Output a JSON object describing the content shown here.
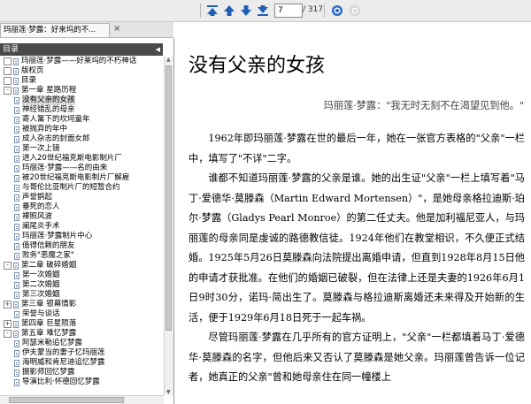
{
  "toolbar": {
    "buttons": [
      "first-page-icon",
      "prev-page-icon",
      "next-page-icon",
      "last-page-icon",
      "zoom-in-icon",
      "zoom-out-icon"
    ],
    "page_value": "7",
    "page_total": "/ 317"
  },
  "tab": {
    "label": "玛丽莲·梦露：好来坞的不...",
    "close": "×"
  },
  "panel": {
    "title": "目录",
    "collapse": "◀"
  },
  "toc": [
    {
      "label": "玛丽莲·梦露——好莱坞的不朽神话",
      "level": 0,
      "expander": "",
      "selected": false
    },
    {
      "label": "版权页",
      "level": 0,
      "expander": "",
      "selected": false
    },
    {
      "label": "目录",
      "level": 0,
      "expander": "",
      "selected": false
    },
    {
      "label": "第一章  星路历程",
      "level": 0,
      "expander": "-",
      "selected": false
    },
    {
      "label": "没有父亲的女孩",
      "level": 1,
      "expander": "",
      "selected": true
    },
    {
      "label": "神经错乱的母亲",
      "level": 1,
      "expander": "",
      "selected": false
    },
    {
      "label": "寄人篱下的坎坷童年",
      "level": 1,
      "expander": "",
      "selected": false
    },
    {
      "label": "被抛弃的年中",
      "level": 1,
      "expander": "",
      "selected": false
    },
    {
      "label": "成人杂志的封面女郎",
      "level": 1,
      "expander": "",
      "selected": false
    },
    {
      "label": "第一次上镜",
      "level": 1,
      "expander": "",
      "selected": false
    },
    {
      "label": "进入20世纪福克斯电影制片厂",
      "level": 1,
      "expander": "",
      "selected": false
    },
    {
      "label": "玛丽莲·梦露——名的由来",
      "level": 1,
      "expander": "",
      "selected": false
    },
    {
      "label": "被20世纪福克斯电影制片厂解雇",
      "level": 1,
      "expander": "",
      "selected": false
    },
    {
      "label": "与哥伦比亚制片厂的短暂合约",
      "level": 1,
      "expander": "",
      "selected": false
    },
    {
      "label": "声誉鹊起",
      "level": 1,
      "expander": "",
      "selected": false
    },
    {
      "label": "垂死的恋人",
      "level": 1,
      "expander": "",
      "selected": false
    },
    {
      "label": "裸照风波",
      "level": 1,
      "expander": "",
      "selected": false
    },
    {
      "label": "阑尾炎手术",
      "level": 1,
      "expander": "",
      "selected": false
    },
    {
      "label": "玛丽莲·梦露制片中心",
      "level": 1,
      "expander": "",
      "selected": false
    },
    {
      "label": "值得信赖的朋友",
      "level": 1,
      "expander": "",
      "selected": false
    },
    {
      "label": "败务\"恶魔之家\"",
      "level": 1,
      "expander": "",
      "selected": false
    },
    {
      "label": "第二章  破碎婚姻",
      "level": 0,
      "expander": "-",
      "selected": false
    },
    {
      "label": "第一次婚姻",
      "level": 1,
      "expander": "",
      "selected": false
    },
    {
      "label": "第二次婚姻",
      "level": 1,
      "expander": "",
      "selected": false
    },
    {
      "label": "第三次婚姻",
      "level": 1,
      "expander": "",
      "selected": false
    },
    {
      "label": "第三章  银幕情影",
      "level": 0,
      "expander": "+",
      "selected": false
    },
    {
      "label": "荣誉与谈话",
      "level": 1,
      "expander": "",
      "selected": false
    },
    {
      "label": "第四章  巨星陨落",
      "level": 0,
      "expander": "+",
      "selected": false
    },
    {
      "label": "第五章  难忆梦露",
      "level": 0,
      "expander": "-",
      "selected": false
    },
    {
      "label": "阿瑟米勒追忆梦露",
      "level": 1,
      "expander": "",
      "selected": false
    },
    {
      "label": "伊夫蒙当的妻子忆玛丽莲",
      "level": 1,
      "expander": "",
      "selected": false
    },
    {
      "label": "海明威和肯尼迪追忆梦露",
      "level": 1,
      "expander": "",
      "selected": false
    },
    {
      "label": "摄影师回忆梦露",
      "level": 1,
      "expander": "",
      "selected": false
    },
    {
      "label": "导演比利·怀德回忆梦露",
      "level": 1,
      "expander": "",
      "selected": false
    }
  ],
  "document": {
    "title": "没有父亲的女孩",
    "epigraph": "玛丽莲·梦露：\"我无时无刻不在渴望见到他。\"",
    "paragraphs": [
      "1962年即玛丽莲·梦露在世的最后一年，她在一张官方表格的\"父亲\"一栏中，填写了\"不详\"二字。",
      "谁都不知道玛丽莲·梦露的父亲是谁。她的出生证\"父亲\"一栏上填写着\"马丁·爱德华·莫滕森（Martin Edward Mortensen）\"，是她母亲格拉迪斯·珀尔·梦露（Gladys Pearl Monroe）的第二任丈夫。他是加利福尼亚人，与玛丽莲的母亲同是虔诚的路德教信徒。1924年他们在教堂相识，不久便正式结婚。1925年5月26日莫滕森向法院提出离婚申请，但直到1928年8月15日他的申请才获批准。在他们的婚姻已破裂，但在法律上还是夫妻的1926年6月1日9时30分，诺玛·简出生了。莫滕森与格拉迪斯离婚还未来得及开始新的生活，便于1929年6月18日死于一起车祸。",
      "尽管玛丽莲·梦露在几乎所有的官方证明上，\"父亲\"一栏都填着马丁·爱德华·莫滕森的名字，但他后来又否认了莫滕森是她父亲。玛丽莲曾告诉一位记者，她真正的父亲\"曾和她母亲住在同一幢楼上"
    ]
  },
  "colors": {
    "toolbar_bg": "#ececec",
    "panel_header_bg": "#4a4a4a",
    "nav_icon_blue": "#1f5fb5"
  }
}
